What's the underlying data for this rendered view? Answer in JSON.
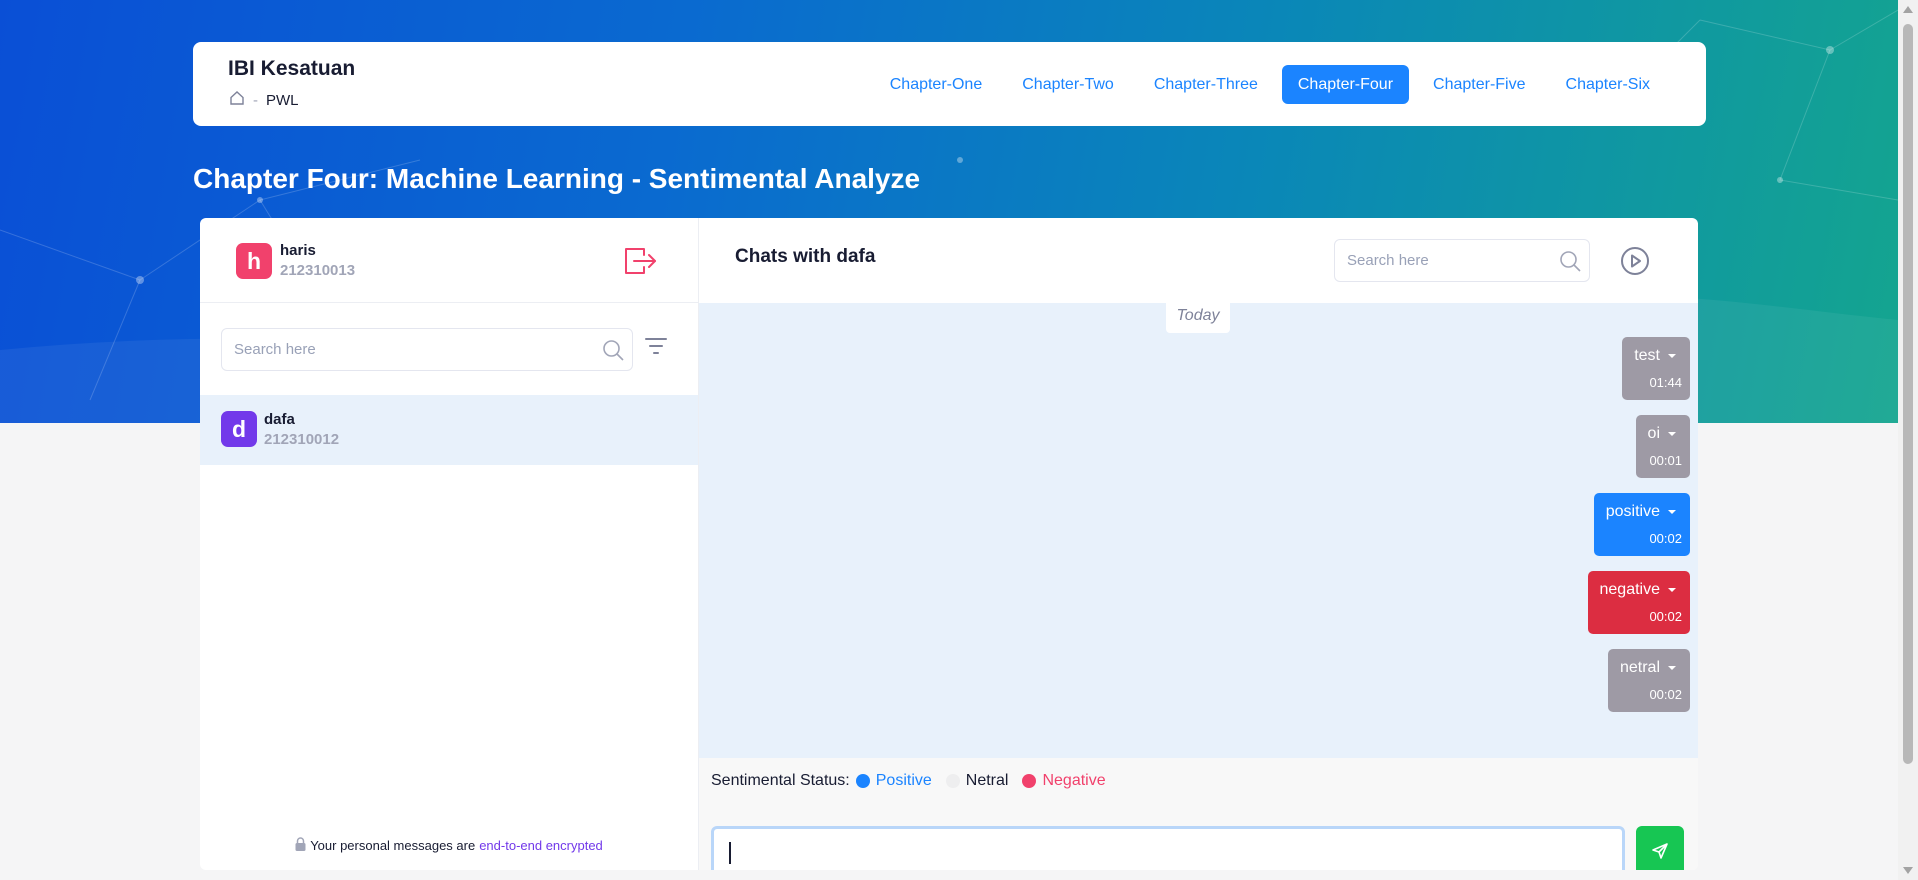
{
  "header": {
    "brand": "IBI Kesatuan",
    "breadcrumb": {
      "home_icon": "home-icon",
      "separator": "-",
      "current": "PWL"
    },
    "nav": [
      {
        "label": "Chapter-One",
        "active": false
      },
      {
        "label": "Chapter-Two",
        "active": false
      },
      {
        "label": "Chapter-Three",
        "active": false
      },
      {
        "label": "Chapter-Four",
        "active": true
      },
      {
        "label": "Chapter-Five",
        "active": false
      },
      {
        "label": "Chapter-Six",
        "active": false
      }
    ]
  },
  "page_title": "Chapter Four: Machine Learning - Sentimental Analyze",
  "sidebar": {
    "user": {
      "initial": "h",
      "name": "haris",
      "nim": "212310013"
    },
    "search_placeholder": "Search here",
    "contacts": [
      {
        "initial": "d",
        "name": "dafa",
        "nim": "212310012"
      }
    ],
    "encryption": {
      "prefix": "Your personal messages are",
      "link": "end-to-end encrypted"
    }
  },
  "chat": {
    "title": "Chats with dafa",
    "search_placeholder": "Search here",
    "day_label": "Today",
    "messages": [
      {
        "text": "test",
        "time": "01:44",
        "sentiment": "netral"
      },
      {
        "text": "oi",
        "time": "00:01",
        "sentiment": "netral"
      },
      {
        "text": "positive",
        "time": "00:02",
        "sentiment": "positive"
      },
      {
        "text": "negative",
        "time": "00:02",
        "sentiment": "negative"
      },
      {
        "text": "netral",
        "time": "00:02",
        "sentiment": "netral"
      }
    ],
    "status": {
      "label": "Sentimental Status:",
      "positive": "Positive",
      "netral": "Netral",
      "negative": "Negative"
    },
    "input_value": ""
  },
  "colors": {
    "primary": "#1b84ff",
    "danger": "#f1416c",
    "negative_bubble": "#dc2d41",
    "netral_bubble": "#9e9aa5",
    "success": "#17c653",
    "avatar_me": "#f1416c",
    "avatar_contact": "#7239ea"
  }
}
